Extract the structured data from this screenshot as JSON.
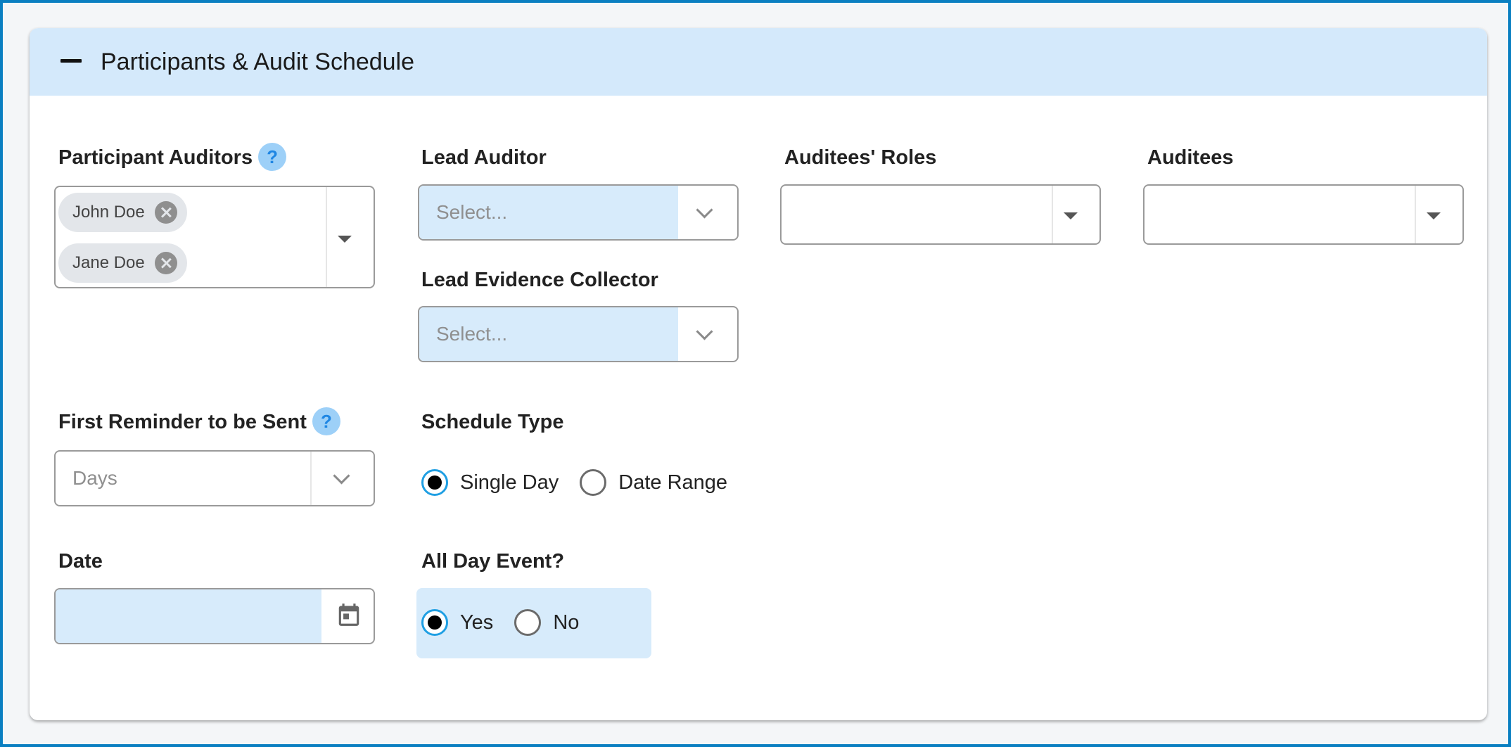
{
  "section": {
    "title": "Participants & Audit Schedule",
    "icon": "minus-icon"
  },
  "participant_auditors": {
    "label": "Participant Auditors",
    "help": "?",
    "chips": [
      "John Doe",
      "Jane Doe"
    ]
  },
  "lead_auditor": {
    "label": "Lead Auditor",
    "placeholder": "Select..."
  },
  "lead_evidence_collector": {
    "label": "Lead Evidence Collector",
    "placeholder": "Select..."
  },
  "auditees_roles": {
    "label": "Auditees' Roles",
    "value": ""
  },
  "auditees": {
    "label": "Auditees",
    "value": ""
  },
  "first_reminder": {
    "label": "First Reminder to be Sent",
    "help": "?",
    "placeholder": "Days"
  },
  "schedule_type": {
    "label": "Schedule Type",
    "options": [
      "Single Day",
      "Date Range"
    ],
    "selected": "Single Day"
  },
  "date": {
    "label": "Date",
    "value": ""
  },
  "all_day_event": {
    "label": "All Day Event?",
    "options": [
      "Yes",
      "No"
    ],
    "selected": "Yes"
  },
  "colors": {
    "frame_border": "#0a7fc1",
    "header_bg": "#d4e9fb",
    "field_highlight": "#d7ebfb",
    "radio_accent": "#1f9fe3",
    "help_bg": "#9dd0f8"
  }
}
